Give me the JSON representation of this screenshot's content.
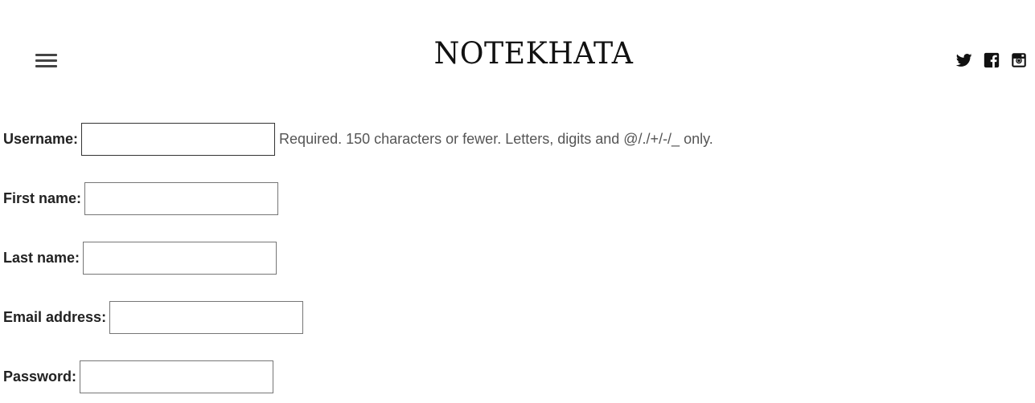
{
  "header": {
    "title": "NOTEKHATA",
    "menu_icon": "hamburger-menu-icon",
    "social": [
      {
        "name": "twitter",
        "icon": "twitter-icon"
      },
      {
        "name": "facebook",
        "icon": "facebook-icon"
      },
      {
        "name": "instagram",
        "icon": "instagram-icon"
      }
    ]
  },
  "form": {
    "username": {
      "label": "Username:",
      "value": "",
      "help": "Required. 150 characters or fewer. Letters, digits and @/./+/-/_ only."
    },
    "first_name": {
      "label": "First name:",
      "value": ""
    },
    "last_name": {
      "label": "Last name:",
      "value": ""
    },
    "email": {
      "label": "Email address:",
      "value": ""
    },
    "password": {
      "label": "Password:",
      "value": ""
    }
  },
  "colors": {
    "text": "#222222",
    "help_text": "#555555",
    "icon": "#111111",
    "input_border": "#767676"
  }
}
